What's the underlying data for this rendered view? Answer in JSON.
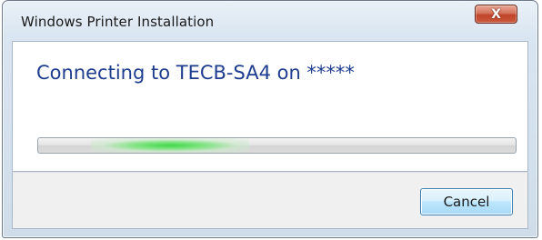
{
  "window": {
    "title": "Windows Printer Installation",
    "close_icon": "x-icon",
    "close_glyph": "X"
  },
  "content": {
    "heading": "Connecting to TECB-SA4 on *****",
    "progress_state": "indeterminate"
  },
  "footer": {
    "cancel_label": "Cancel"
  },
  "colors": {
    "heading_text": "#1e3d8f",
    "progress_glow": "#3fd84a",
    "close_button": "#c1432a",
    "cancel_border": "#3c7fb1"
  }
}
